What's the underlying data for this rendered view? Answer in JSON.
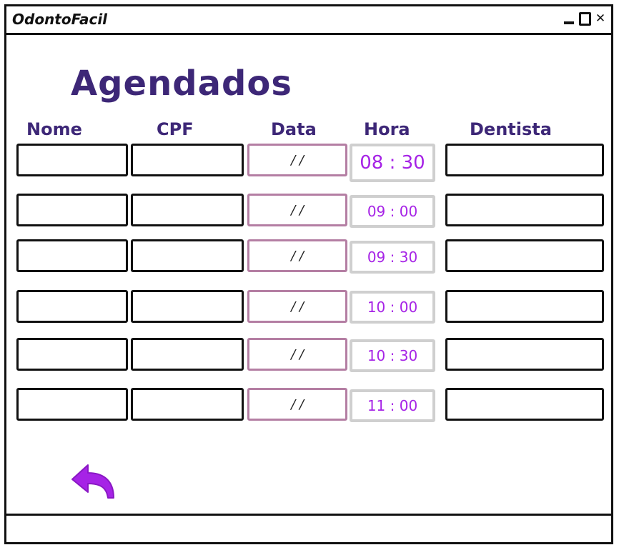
{
  "window": {
    "title": "OdontoFacil",
    "controls": [
      "minimize",
      "maximize",
      "close"
    ],
    "close_glyph": "✕"
  },
  "page": {
    "title": "Agendados"
  },
  "columns": [
    "Nome",
    "CPF",
    "Data",
    "Hora",
    "Dentista"
  ],
  "rows": [
    {
      "nome": "",
      "cpf": "",
      "data": "/ /",
      "hora": "08 : 30",
      "dentista": ""
    },
    {
      "nome": "",
      "cpf": "",
      "data": "/ /",
      "hora": "09 : 00",
      "dentista": ""
    },
    {
      "nome": "",
      "cpf": "",
      "data": "/ /",
      "hora": "09 : 30",
      "dentista": ""
    },
    {
      "nome": "",
      "cpf": "",
      "data": "/ /",
      "hora": "10 : 00",
      "dentista": ""
    },
    {
      "nome": "",
      "cpf": "",
      "data": "/ /",
      "hora": "10 : 30",
      "dentista": ""
    },
    {
      "nome": "",
      "cpf": "",
      "data": "/ /",
      "hora": "11 : 00",
      "dentista": ""
    }
  ],
  "back_button": {
    "icon": "undo-arrow-icon"
  },
  "colors": {
    "heading": "#3d2777",
    "time_text": "#a623e6",
    "date_border": "#b47ea3",
    "time_border": "#cfcfcf",
    "back_arrow": "#a623e6"
  }
}
